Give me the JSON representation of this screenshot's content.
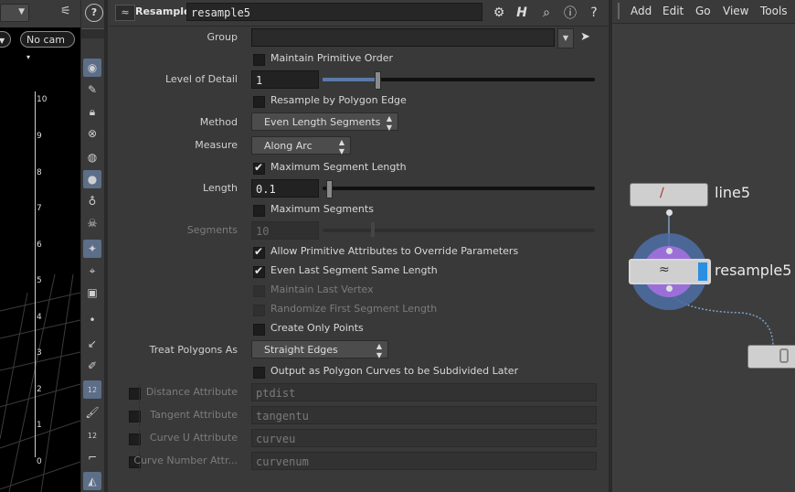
{
  "viewport": {
    "camera_label": "No cam",
    "ruler_ticks": [
      "10",
      "9",
      "8",
      "7",
      "6",
      "5",
      "4",
      "3",
      "2",
      "1",
      "0"
    ]
  },
  "toolbar": {
    "badge_a": "12",
    "badge_b": "12"
  },
  "header": {
    "node_type": "Resample",
    "node_name": "resample5",
    "icons": [
      "gear-icon",
      "h-icon",
      "search-icon",
      "info-icon",
      "help-icon"
    ]
  },
  "params": {
    "group_label": "Group",
    "group_value": "",
    "maintain_primitive_order": {
      "label": "Maintain Primitive Order",
      "checked": false
    },
    "level_of_detail": {
      "label": "Level of Detail",
      "value": "1"
    },
    "resample_by_polygon_edge": {
      "label": "Resample by Polygon Edge",
      "checked": false
    },
    "method": {
      "label": "Method",
      "value": "Even Length Segments"
    },
    "measure": {
      "label": "Measure",
      "value": "Along Arc"
    },
    "maximum_segment_length": {
      "label": "Maximum Segment Length",
      "checked": true
    },
    "length": {
      "label": "Length",
      "value": "0.1"
    },
    "maximum_segments": {
      "label": "Maximum Segments",
      "checked": false
    },
    "segments": {
      "label": "Segments",
      "value": "10"
    },
    "allow_prim_attribs": {
      "label": "Allow Primitive Attributes to Override Parameters",
      "checked": true
    },
    "even_last_segment": {
      "label": "Even Last Segment Same Length",
      "checked": true
    },
    "maintain_last_vertex": {
      "label": "Maintain Last Vertex",
      "checked": false
    },
    "randomize_first_segment": {
      "label": "Randomize First Segment Length",
      "checked": false
    },
    "create_only_points": {
      "label": "Create Only Points",
      "checked": false
    },
    "treat_polygons_as": {
      "label": "Treat Polygons As",
      "value": "Straight Edges"
    },
    "output_polygon_curves": {
      "label": "Output as Polygon Curves to be Subdivided Later",
      "checked": false
    },
    "distance_attribute": {
      "label": "Distance Attribute",
      "value": "ptdist"
    },
    "tangent_attribute": {
      "label": "Tangent Attribute",
      "value": "tangentu"
    },
    "curve_u_attribute": {
      "label": "Curve U Attribute",
      "value": "curveu"
    },
    "curve_number_attribute": {
      "label": "Curve Number Attr...",
      "value": "curvenum"
    }
  },
  "network": {
    "menu": [
      "Add",
      "Edit",
      "Go",
      "View",
      "Tools"
    ],
    "nodes": [
      {
        "name": "line5"
      },
      {
        "name": "resample5",
        "selected": true
      }
    ]
  },
  "colors": {
    "accent": "#5a7aa8",
    "node_selected_ring": "#7a6bc8",
    "node_flag": "#2a8fe0",
    "wire": "#7aa0c8"
  }
}
